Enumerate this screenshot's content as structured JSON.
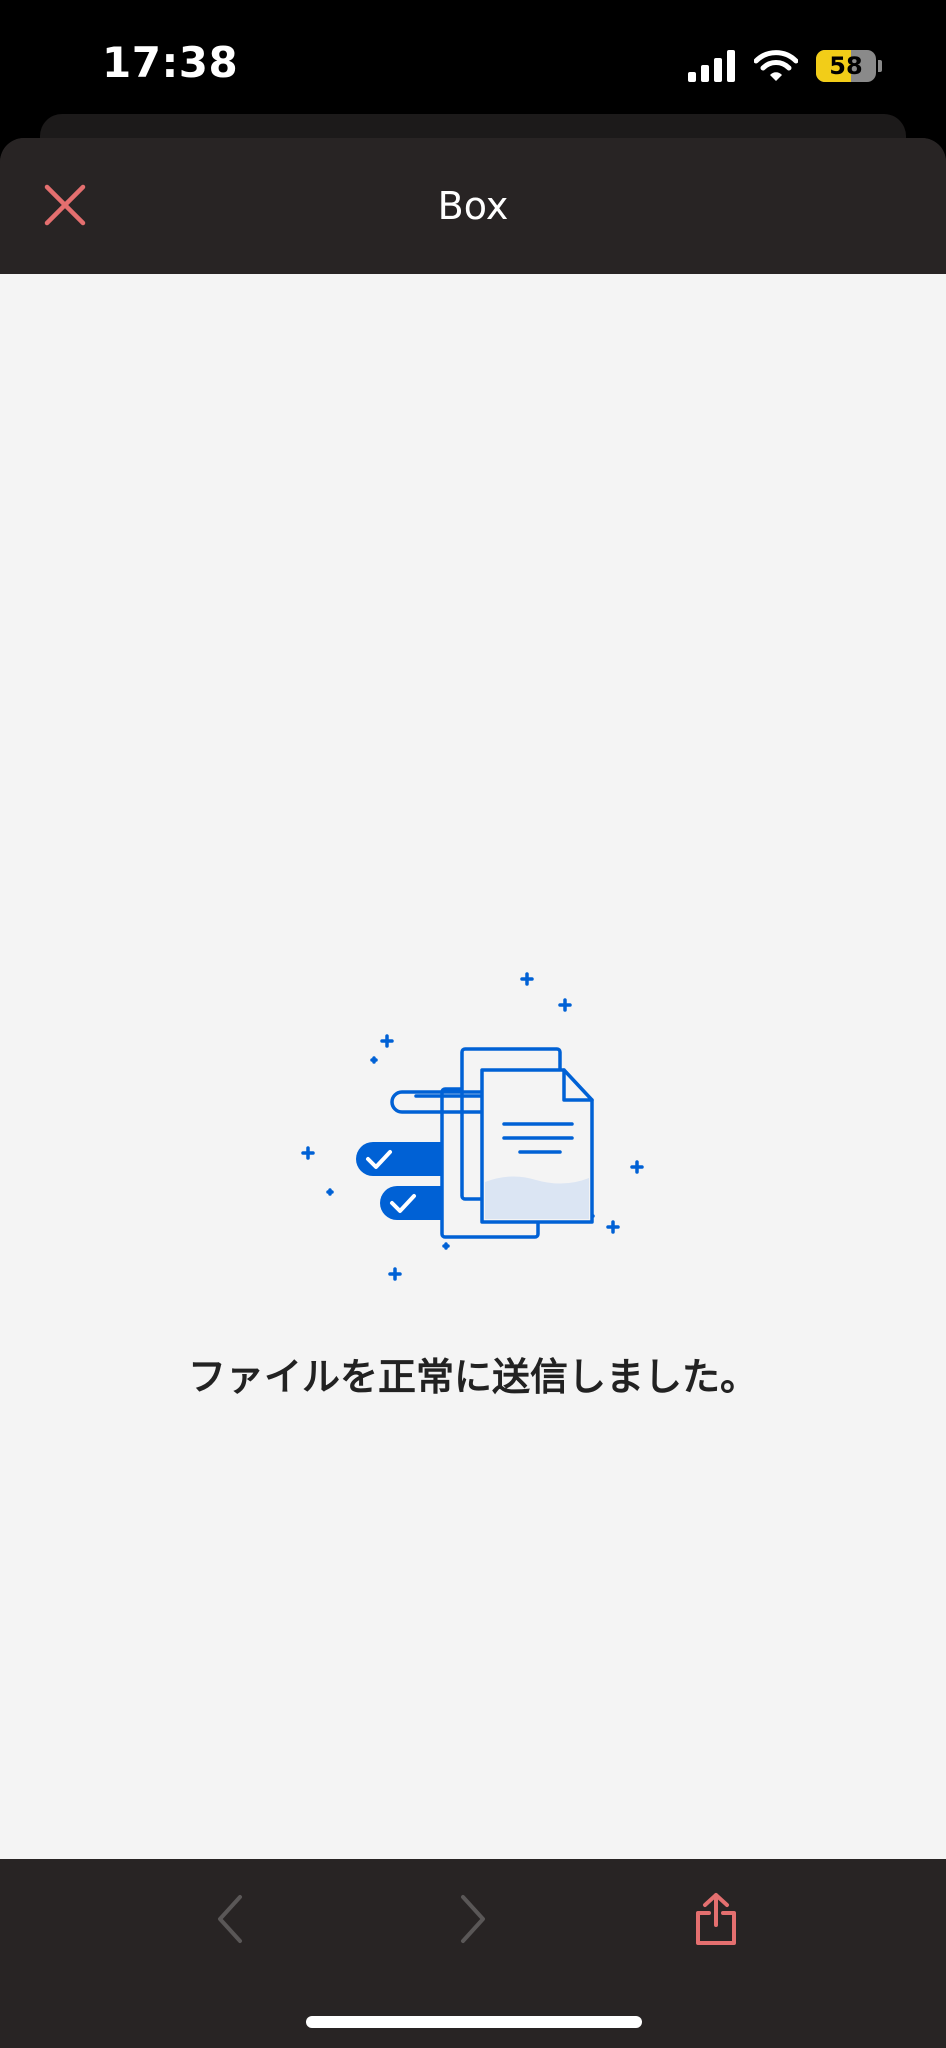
{
  "status_bar": {
    "time": "17:38",
    "battery_level": "58",
    "icons": [
      "signal-icon",
      "wifi-icon",
      "battery-icon"
    ]
  },
  "header": {
    "title": "Box",
    "close_icon": "close-icon"
  },
  "content": {
    "message": "ファイルを正常に送信しました。",
    "illustration": "files-sent-illustration"
  },
  "toolbar": {
    "back_icon": "chevron-left-icon",
    "forward_icon": "chevron-right-icon",
    "share_icon": "share-icon"
  },
  "colors": {
    "accent": "#e46f6f",
    "illustration_blue": "#0061d5",
    "battery": "#f2cd18",
    "chrome": "#282424",
    "content_bg": "#f4f4f4"
  }
}
